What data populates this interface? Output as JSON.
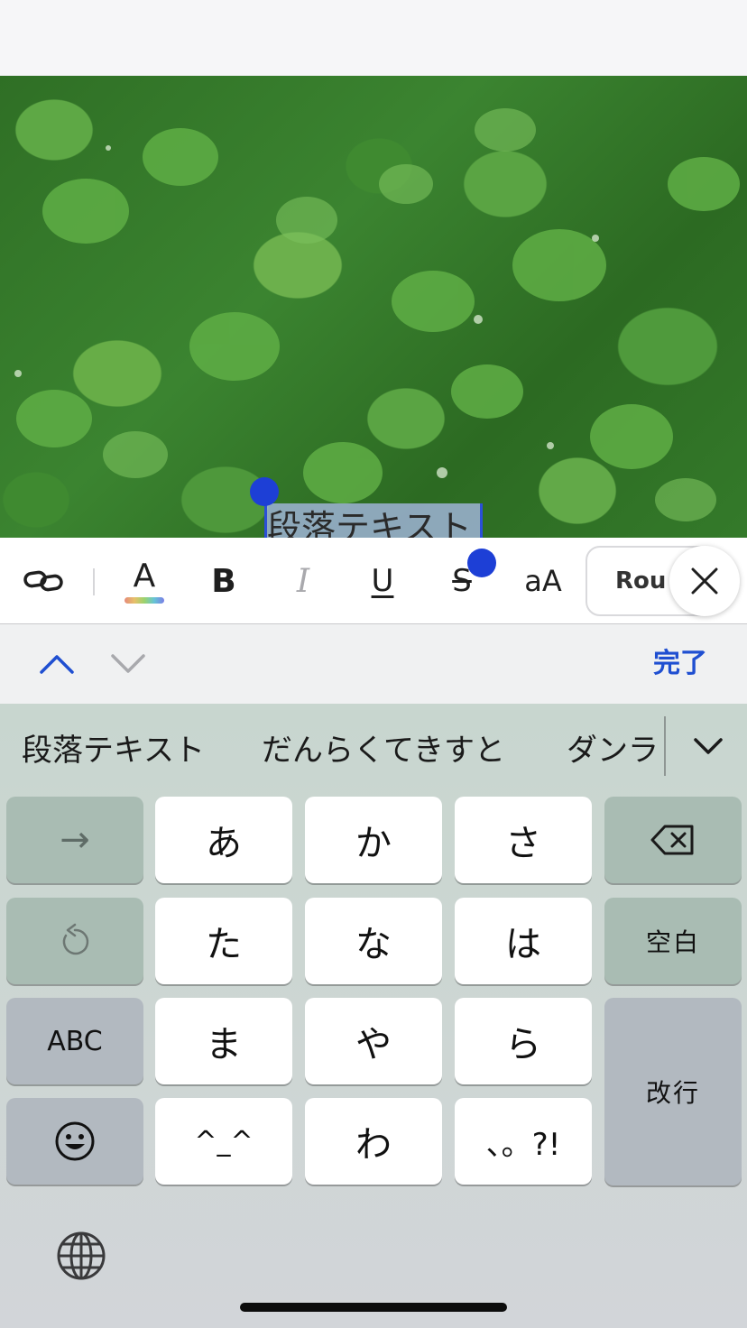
{
  "editor": {
    "selected_text": "段落テキスト"
  },
  "toolbar": {
    "text_color_label": "A",
    "bold_label": "B",
    "italic_label": "I",
    "underline_label": "U",
    "strike_label": "S",
    "case_label": "aA",
    "font_label": "Rou"
  },
  "accessory": {
    "done_label": "完了"
  },
  "candidates": [
    "段落テキスト",
    "だんらくてきすと",
    "ダンラ"
  ],
  "keys": {
    "arrow": "→",
    "a": "あ",
    "ka": "か",
    "sa": "さ",
    "ta": "た",
    "na": "な",
    "ha": "は",
    "space": "空白",
    "abc": "ABC",
    "ma": "ま",
    "ya": "や",
    "ra": "ら",
    "return": "改行",
    "emoticon": "^_^",
    "wa": "わ",
    "punct": "、。?!"
  },
  "colors": {
    "accent": "#1f4fd1",
    "selection_handle": "#1d3fd6",
    "selection_fill": "#aebcee"
  }
}
